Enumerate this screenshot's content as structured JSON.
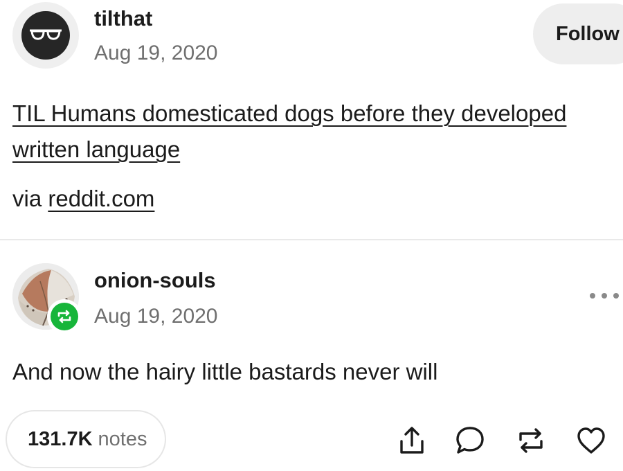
{
  "post": {
    "blog_name": "tilthat",
    "date": "Aug 19, 2020",
    "follow_label": "Follow",
    "title": "TIL Humans domesticated dogs before they developed written language",
    "via_prefix": "via",
    "via_link": "reddit.com",
    "avatar_icon": "sunglasses-face-icon"
  },
  "reblog": {
    "blog_name": "onion-souls",
    "date": "Aug 19, 2020",
    "text": "And now the hairy little bastards never will",
    "avatar_icon": "onion-avatar",
    "badge_icon": "reblog-badge-icon",
    "more_icon": "more-options-icon"
  },
  "footer": {
    "notes_count": "131.7K",
    "notes_label": "notes",
    "actions": [
      "share-icon",
      "reply-icon",
      "reblog-icon",
      "like-icon"
    ]
  },
  "colors": {
    "text": "#1b1b1b",
    "secondary_text": "#6f6f6f",
    "reblog_green": "#17b53a",
    "button_bg": "#eeeeee",
    "divider": "#e9e9e9"
  }
}
